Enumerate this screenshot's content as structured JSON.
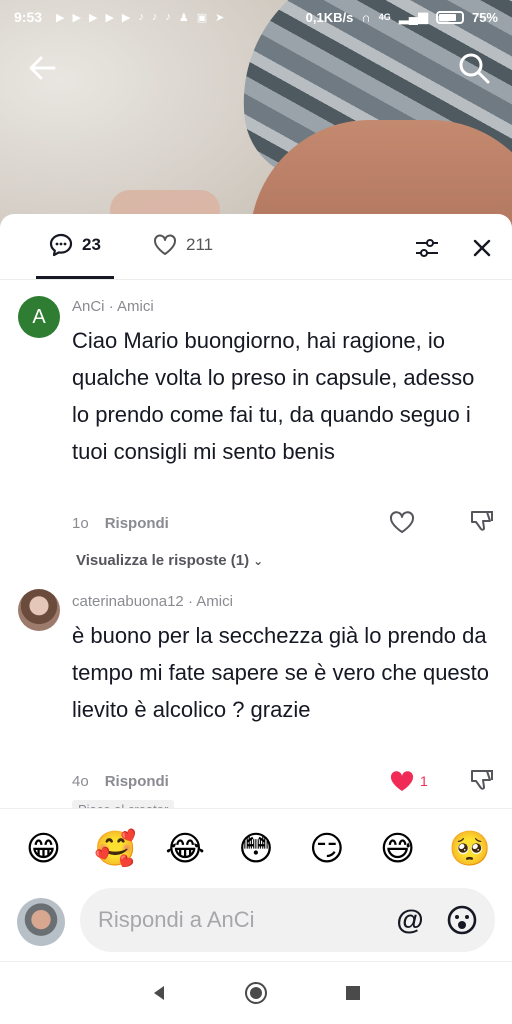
{
  "status_bar": {
    "time": "9:53",
    "net_speed": "0,1KB/s",
    "network": "4G",
    "battery": "75%"
  },
  "header": {
    "comments_count": "23",
    "likes_count": "211"
  },
  "comments": [
    {
      "avatar_letter": "A",
      "username": "AnCi",
      "tag": "Amici",
      "text": "Ciao Mario buongiorno, hai ragione, io qualche volta lo preso in capsule, adesso lo prendo come fai tu, da quando seguo i tuoi consigli mi sento benis",
      "time": "1o",
      "reply_label": "Rispondi",
      "view_replies": "Visualizza le risposte (1)"
    },
    {
      "username": "caterinabuona12",
      "tag": "Amici",
      "text": "è buono per la secchezza già lo prendo da tempo mi fate sapere se è vero che questo lievito è alcolico ? grazie",
      "time": "4o",
      "reply_label": "Rispondi",
      "like_count": "1",
      "creator_badge": "Piace al creator"
    }
  ],
  "emojis": [
    "😁",
    "🥰",
    "😂",
    "😳",
    "😏",
    "😅",
    "🥺"
  ],
  "input": {
    "placeholder": "Rispondi a AnCi",
    "at_symbol": "@"
  },
  "colors": {
    "accent_like": "#f02c56",
    "avatar_green": "#2e7d32",
    "text": "#161823"
  }
}
